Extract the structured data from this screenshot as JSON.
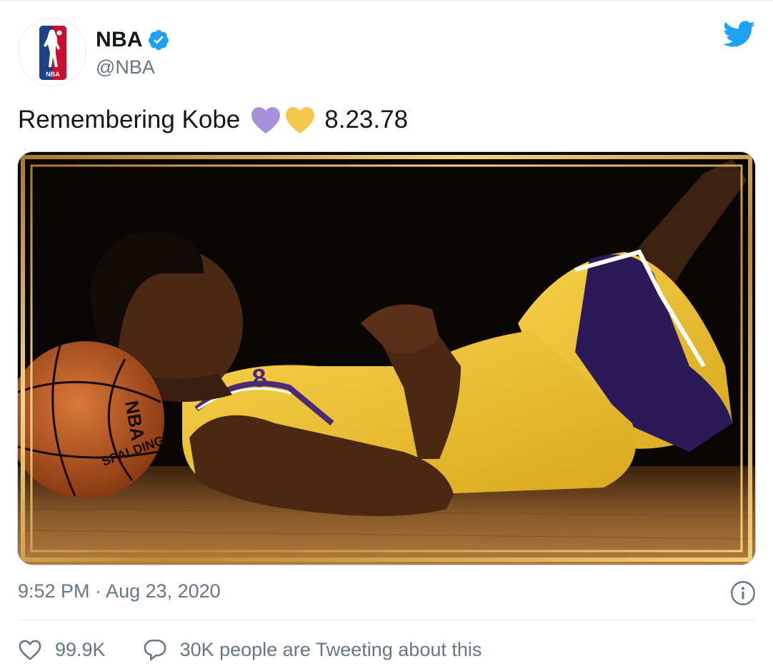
{
  "user": {
    "name": "NBA",
    "handle": "@NBA",
    "avatar_logo_text": "NBA",
    "verified": true
  },
  "tweet": {
    "text_before": "Remembering Kobe",
    "hearts": [
      "purple-heart",
      "yellow-heart"
    ],
    "text_after": "8.23.78",
    "timestamp": "9:52 PM · Aug 23, 2020"
  },
  "media": {
    "ball_text": "NBA",
    "ball_text_2": "SPALDING"
  },
  "stats": {
    "likes": "99.9K",
    "conversation": "30K people are Tweeting about this"
  },
  "colors": {
    "twitter_blue": "#1da1f2",
    "secondary_text": "#657786",
    "heart_purple": "#a88fdc",
    "heart_yellow": "#f5c84c",
    "gold_frame": "#d9a94a"
  },
  "icons": [
    "verified-badge-icon",
    "twitter-bird-icon",
    "info-icon",
    "like-heart-icon",
    "conversation-bubble-icon"
  ]
}
